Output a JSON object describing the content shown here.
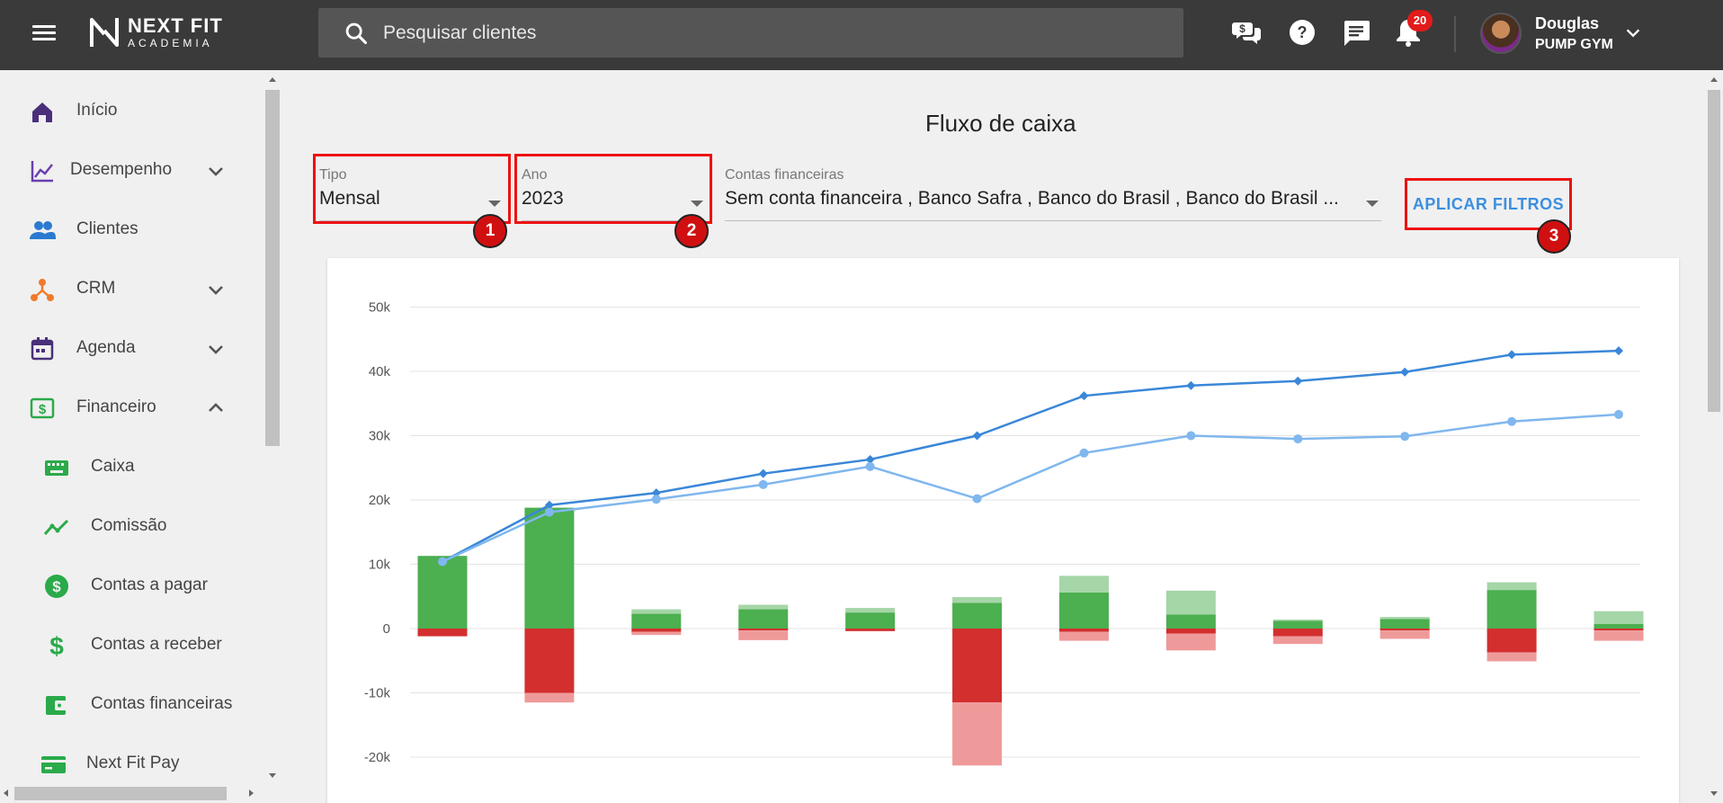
{
  "header": {
    "logo_line1": "NEXT FIT",
    "logo_line2": "ACADEMIA",
    "search_placeholder": "Pesquisar clientes",
    "notification_count": "20",
    "user_name": "Douglas",
    "user_gym": "PUMP GYM"
  },
  "sidebar": {
    "items": [
      {
        "label": "Início",
        "icon": "home-icon",
        "color": "#4a2f7a"
      },
      {
        "label": "Desempenho",
        "icon": "chart-line-icon",
        "color": "#6a3fb0"
      },
      {
        "label": "Clientes",
        "icon": "people-icon",
        "color": "#2a7ad0"
      },
      {
        "label": "CRM",
        "icon": "crm-icon",
        "color": "#f07b2c"
      },
      {
        "label": "Agenda",
        "icon": "calendar-icon",
        "color": "#4a2f7a"
      },
      {
        "label": "Financeiro",
        "icon": "money-icon",
        "color": "#2aaa4a"
      },
      {
        "label": "Caixa",
        "icon": "keyboard-icon",
        "color": "#2aaa4a"
      },
      {
        "label": "Comissão",
        "icon": "trend-icon",
        "color": "#2aaa4a"
      },
      {
        "label": "Contas a pagar",
        "icon": "dollar-circle-icon",
        "color": "#2aaa4a"
      },
      {
        "label": "Contas a receber",
        "icon": "dollar-icon",
        "color": "#2aaa4a"
      },
      {
        "label": "Contas financeiras",
        "icon": "wallet-icon",
        "color": "#2aaa4a"
      },
      {
        "label": "Next Fit Pay",
        "icon": "card-icon",
        "color": "#2aaa4a"
      }
    ]
  },
  "main": {
    "title": "Fluxo de caixa",
    "filters": {
      "tipo_label": "Tipo",
      "tipo_value": "Mensal",
      "ano_label": "Ano",
      "ano_value": "2023",
      "contas_label": "Contas financeiras",
      "contas_value": "Sem conta financeira , Banco Safra , Banco do Brasil , Banco do Brasil ...",
      "apply_label": "APLICAR FILTROS"
    },
    "annotations": [
      "1",
      "2",
      "3"
    ]
  },
  "chart_data": {
    "type": "bar",
    "title": "",
    "ylim": [
      -25000,
      55000
    ],
    "yticks": [
      50000,
      40000,
      30000,
      20000,
      10000,
      0,
      -10000,
      -20000
    ],
    "ytick_labels": [
      "50k",
      "40k",
      "30k",
      "20k",
      "10k",
      "0",
      "-10k",
      "-20k"
    ],
    "grid": true,
    "x": [
      1,
      2,
      3,
      4,
      5,
      6,
      7,
      8,
      9,
      10,
      11,
      12
    ],
    "series": [
      {
        "kind": "bar_pos",
        "color": "#4caf50",
        "values": [
          11300,
          18800,
          2300,
          3000,
          2500,
          4000,
          5600,
          2200,
          1200,
          1500,
          6000,
          700
        ]
      },
      {
        "kind": "bar_pos_light",
        "color": "#a5d6a7",
        "values": [
          0,
          0,
          700,
          700,
          700,
          900,
          2600,
          3700,
          200,
          300,
          1200,
          2000
        ]
      },
      {
        "kind": "bar_neg",
        "color": "#d32f2f",
        "values": [
          -1200,
          -10000,
          -500,
          -300,
          -400,
          -11500,
          -500,
          -800,
          -1200,
          -300,
          -3700,
          -300
        ]
      },
      {
        "kind": "bar_neg_light",
        "color": "#ef9a9a",
        "values": [
          0,
          -1500,
          -500,
          -1500,
          0,
          -9800,
          -1400,
          -2600,
          -1200,
          -1300,
          -1400,
          -1600
        ]
      },
      {
        "kind": "line",
        "color": "#3a87d8",
        "marker": "diamond",
        "values": [
          10400,
          19200,
          21100,
          24100,
          26300,
          30000,
          36200,
          37800,
          38500,
          39900,
          42600,
          43200
        ]
      },
      {
        "kind": "line",
        "color": "#80b7ee",
        "marker": "circle",
        "values": [
          10400,
          18100,
          20100,
          22400,
          25200,
          20200,
          27300,
          30000,
          29500,
          29900,
          32200,
          33300
        ]
      }
    ]
  }
}
